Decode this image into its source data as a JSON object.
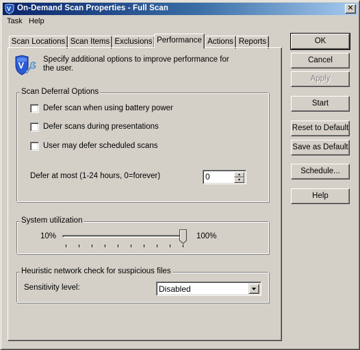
{
  "window": {
    "title": "On-Demand Scan Properties - Full Scan",
    "close_label": "✕"
  },
  "menu": [
    {
      "label": "Task"
    },
    {
      "label": "Help"
    }
  ],
  "tabs": [
    {
      "label": "Scan Locations",
      "selected": false
    },
    {
      "label": "Scan Items",
      "selected": false
    },
    {
      "label": "Exclusions",
      "selected": false
    },
    {
      "label": "Performance",
      "selected": true
    },
    {
      "label": "Actions",
      "selected": false
    },
    {
      "label": "Reports",
      "selected": false
    }
  ],
  "performance": {
    "intro_text": "Specify additional options to improve performance for the user.",
    "intro_icon": "shield-wrench-icon",
    "deferral": {
      "legend": "Scan Deferral Options",
      "options": [
        {
          "label": "Defer scan when using battery power",
          "checked": false
        },
        {
          "label": "Defer scans during presentations",
          "checked": false
        },
        {
          "label": "User may defer scheduled scans",
          "checked": false
        }
      ],
      "defer_at_most_label": "Defer at most (1-24 hours, 0=forever)",
      "defer_at_most_value": "0"
    },
    "utilization": {
      "legend": "System utilization",
      "min_label": "10%",
      "max_label": "100%",
      "min": 10,
      "max": 100,
      "step": 10,
      "value": 100
    },
    "heuristic": {
      "legend": "Heuristic network check for suspicious files",
      "sensitivity_label": "Sensitivity level:",
      "sensitivity_value": "Disabled"
    }
  },
  "buttons": {
    "ok": "OK",
    "cancel": "Cancel",
    "apply": "Apply",
    "start": "Start",
    "reset": "Reset to Default",
    "save": "Save as Default",
    "schedule": "Schedule...",
    "help": "Help"
  }
}
